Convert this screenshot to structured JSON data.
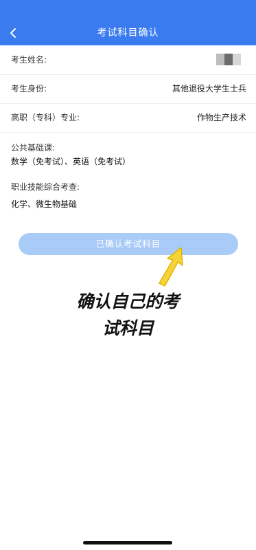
{
  "header": {
    "title": "考试科目确认",
    "back_icon": "chevron-left-icon"
  },
  "fields": {
    "name": {
      "label": "考生姓名:",
      "value_masked": true
    },
    "identity": {
      "label": "考生身份:",
      "value": "其他退役大学生士兵"
    },
    "major": {
      "label": "高职（专科）专业:",
      "value": "作物生产技术"
    },
    "public_courses": {
      "label": "公共基础课:",
      "value": "数学（免考试）、英语（免考试）"
    },
    "vocational": {
      "label": "职业技能综合考查:",
      "value": "化学、微生物基础"
    }
  },
  "confirm_button": {
    "label": "已确认考试科目",
    "state": "disabled"
  },
  "annotation": {
    "line1": "确认自己的考",
    "line2": "试科目",
    "icon": "yellow-arrow-icon"
  },
  "colors": {
    "primary": "#3a7bf0",
    "button_disabled": "#a9cbf8",
    "arrow": "#f5d33a"
  }
}
